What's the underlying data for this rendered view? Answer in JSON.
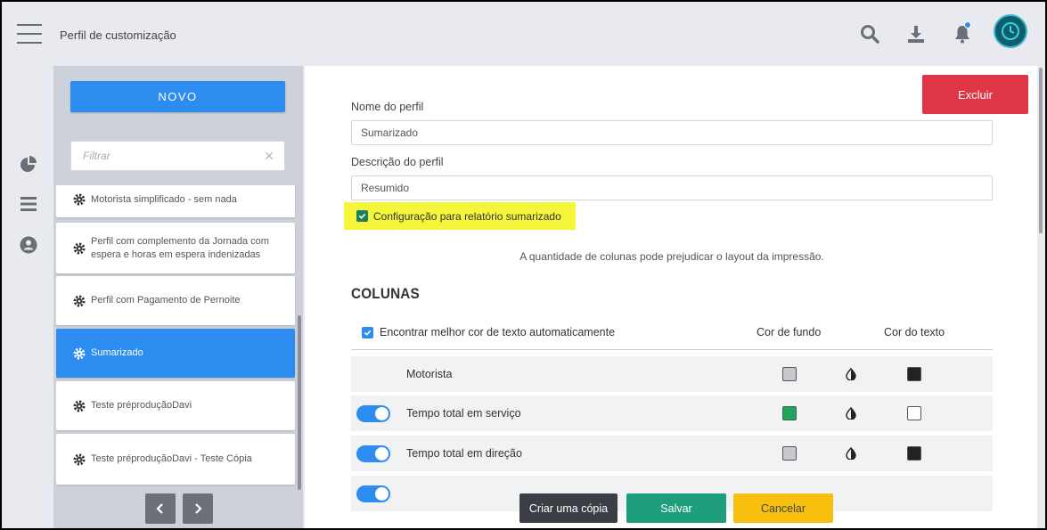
{
  "header": {
    "title": "Perfil de customização",
    "icons": [
      "menu-icon",
      "search-icon",
      "download-icon",
      "bell-icon",
      "avatar"
    ]
  },
  "rail": {
    "icons": [
      "pie-chart-icon",
      "list-icon",
      "user-icon"
    ]
  },
  "profiles_panel": {
    "new_button": "NOVO",
    "filter_placeholder": "Filtrar",
    "items": [
      {
        "label": "Motorista simplificado - sem nada",
        "active": false
      },
      {
        "label": "Perfil com complemento da Jornada com espera e horas em espera indenizadas",
        "active": false
      },
      {
        "label": "Perfil com Pagamento de Pernoite",
        "active": false
      },
      {
        "label": "Sumarizado",
        "active": true
      },
      {
        "label": "Teste préproduçãoDavi",
        "active": false
      },
      {
        "label": "Teste préproduçãoDavi - Teste Cópia",
        "active": false
      }
    ],
    "pager": {
      "prev": "‹",
      "next": "›"
    }
  },
  "form": {
    "delete_button": "Excluir",
    "name_label": "Nome do perfil",
    "name_value": "Sumarizado",
    "description_label": "Descrição do perfil",
    "description_value": "Resumido",
    "summary_config_label": "Configuração para relatório sumarizado",
    "summary_config_checked": true,
    "note": "A quantidade de colunas pode prejudicar o layout da impressão."
  },
  "columns": {
    "title": "COLUNAS",
    "auto_text_color_label": "Encontrar melhor cor de texto automaticamente",
    "auto_text_color_checked": true,
    "header_bg": "Cor de fundo",
    "header_text": "Cor do texto",
    "rows": [
      {
        "name": "Motorista",
        "toggle": null,
        "bg_color": "#c8c9cc",
        "text_color": "#222222"
      },
      {
        "name": "Tempo total em serviço",
        "toggle": true,
        "bg_color": "#1fa65a",
        "text_color": "#ffffff"
      },
      {
        "name": "Tempo total em direção",
        "toggle": true,
        "bg_color": "#c8c9cc",
        "text_color": "#222222"
      }
    ]
  },
  "footer": {
    "copy_button": "Criar uma cópia",
    "save_button": "Salvar",
    "cancel_button": "Cancelar"
  },
  "colors": {
    "primary": "#2d8cf0",
    "danger": "#e03546",
    "success": "#1e9e7a",
    "warning": "#f7c00f",
    "highlight": "#f5f53b"
  }
}
